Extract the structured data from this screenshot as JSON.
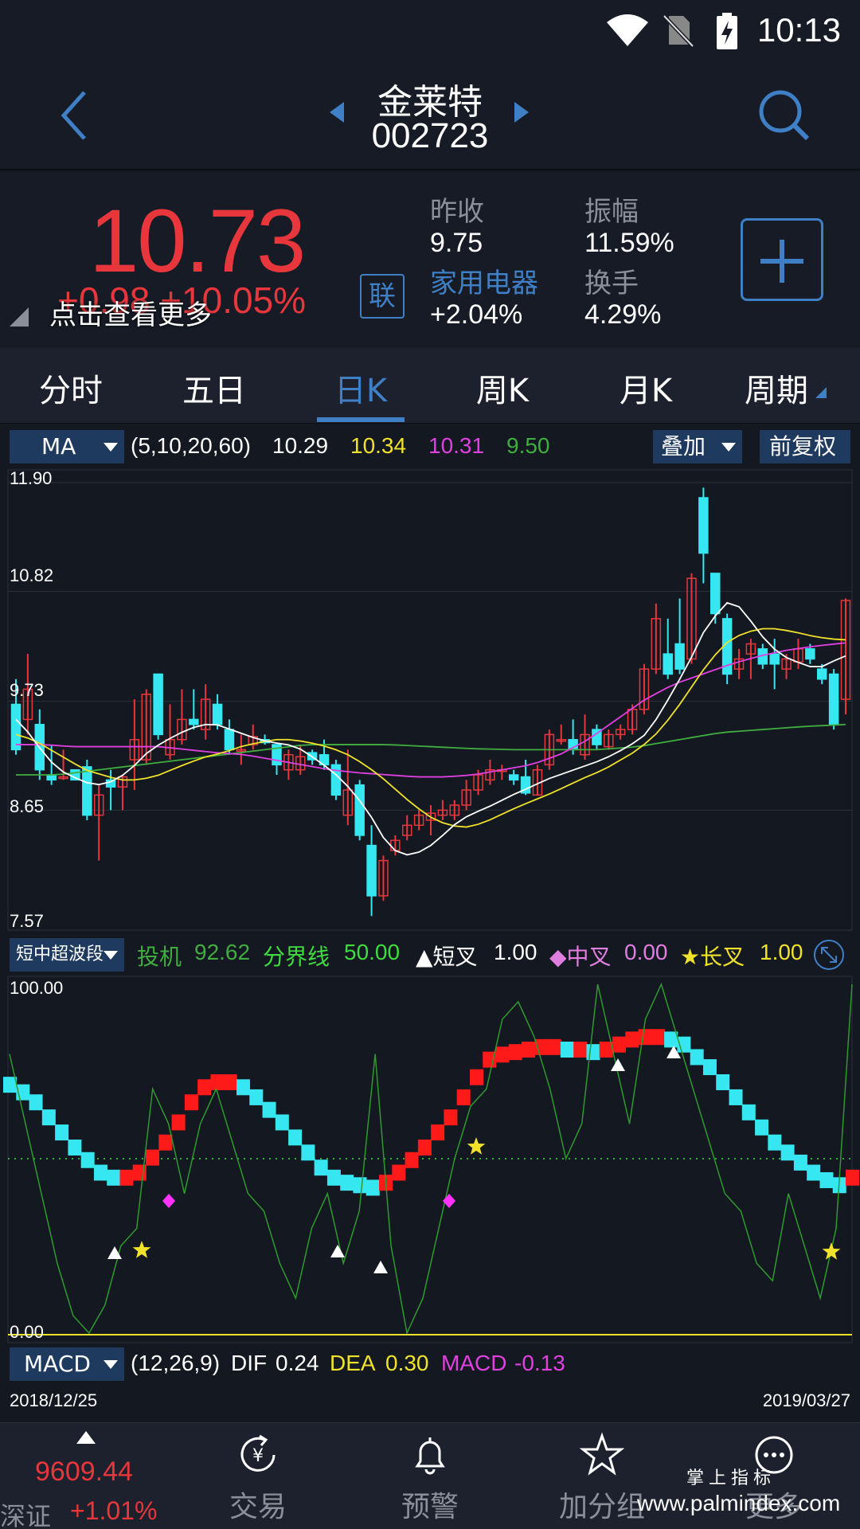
{
  "status": {
    "time": "10:13",
    "icons": [
      "wifi-icon",
      "no-sim-icon",
      "battery-charging-icon"
    ]
  },
  "header": {
    "name": "金莱特",
    "code": "002723"
  },
  "quote": {
    "price": "10.73",
    "change": "+0.98  +10.05%",
    "more_tip": "点击查看更多",
    "lian_label": "联",
    "prev_close_label": "昨收",
    "prev_close": "9.75",
    "amplitude_label": "振幅",
    "amplitude": "11.59%",
    "industry_label": "家用电器",
    "industry_change": "+2.04%",
    "turnover_label": "换手",
    "turnover": "4.29%"
  },
  "tabs": [
    "分时",
    "五日",
    "日K",
    "周K",
    "月K",
    "周期"
  ],
  "ma_bar": {
    "selector": "MA",
    "params": "(5,10,20,60)",
    "ma5": "10.29",
    "ma10": "10.34",
    "ma20": "10.31",
    "ma60": "9.50",
    "overlay": "叠加",
    "adjust": "前复权"
  },
  "price_axis": [
    "11.90",
    "10.82",
    "9.73",
    "8.65",
    "7.57"
  ],
  "indicator_bar": {
    "selector": "短中超波段",
    "t1_label": "投机",
    "t1_value": "92.62",
    "t2_label": "分界线",
    "t2_value": "50.00",
    "t3_label": "▲短叉",
    "t3_value": "1.00",
    "t4_label": "◆中叉",
    "t4_value": "0.00",
    "t5_label": "★长叉",
    "t5_value": "1.00"
  },
  "indicator_axis": [
    "100.00",
    "0.00"
  ],
  "macd_bar": {
    "selector": "MACD",
    "params": "(12,26,9)",
    "dif_label": "DIF",
    "dif": "0.24",
    "dea_label": "DEA",
    "dea": "0.30",
    "macd_label": "MACD",
    "macd": "-0.13"
  },
  "dates": {
    "start": "2018/12/25",
    "end": "2019/03/27"
  },
  "bottom_nav": {
    "index_value": "9609.44",
    "index_name": "深证",
    "index_change": "+1.01%",
    "items": [
      "交易",
      "预警",
      "加分组",
      "更多"
    ]
  },
  "watermark": {
    "line1": "掌上指标",
    "line2": "www.palmindex.com"
  },
  "colors": {
    "up": "#e7373c",
    "down": "#36e6f0",
    "accent": "#3f7fc6",
    "ma5": "#ffffff",
    "ma10": "#f0e22a",
    "ma20": "#e040e0",
    "ma60": "#3fae3f"
  },
  "chart_data": {
    "type": "candlestick",
    "ylim": [
      7.57,
      11.9
    ],
    "candles": [
      {
        "o": 9.7,
        "c": 9.25,
        "h": 9.95,
        "l": 9.2
      },
      {
        "o": 9.55,
        "c": 9.85,
        "h": 10.2,
        "l": 9.4
      },
      {
        "o": 9.5,
        "c": 9.05,
        "h": 9.65,
        "l": 8.95
      },
      {
        "o": 9.0,
        "c": 8.95,
        "h": 9.3,
        "l": 8.9
      },
      {
        "o": 8.98,
        "c": 8.98,
        "h": 9.25,
        "l": 8.95
      },
      {
        "o": 9.05,
        "c": 8.95,
        "h": 9.05,
        "l": 8.95
      },
      {
        "o": 9.08,
        "c": 8.6,
        "h": 9.15,
        "l": 8.55
      },
      {
        "o": 8.6,
        "c": 8.8,
        "h": 8.9,
        "l": 8.15
      },
      {
        "o": 8.95,
        "c": 8.88,
        "h": 9.05,
        "l": 8.65
      },
      {
        "o": 8.88,
        "c": 8.98,
        "h": 9.0,
        "l": 8.65
      },
      {
        "o": 9.15,
        "c": 9.35,
        "h": 9.75,
        "l": 8.85
      },
      {
        "o": 9.15,
        "c": 9.8,
        "h": 9.85,
        "l": 9.1
      },
      {
        "o": 10.0,
        "c": 9.4,
        "h": 10.0,
        "l": 9.35
      },
      {
        "o": 9.2,
        "c": 9.35,
        "h": 9.7,
        "l": 9.15
      },
      {
        "o": 9.35,
        "c": 9.55,
        "h": 9.85,
        "l": 9.3
      },
      {
        "o": 9.55,
        "c": 9.5,
        "h": 9.85,
        "l": 9.45
      },
      {
        "o": 9.45,
        "c": 9.75,
        "h": 9.9,
        "l": 9.35
      },
      {
        "o": 9.7,
        "c": 9.5,
        "h": 9.8,
        "l": 9.45
      },
      {
        "o": 9.45,
        "c": 9.25,
        "h": 9.55,
        "l": 9.2
      },
      {
        "o": 9.25,
        "c": 9.25,
        "h": 9.4,
        "l": 9.1
      },
      {
        "o": 9.3,
        "c": 9.38,
        "h": 9.5,
        "l": 9.25
      },
      {
        "o": 9.35,
        "c": 9.32,
        "h": 9.4,
        "l": 9.3
      },
      {
        "o": 9.3,
        "c": 9.1,
        "h": 9.3,
        "l": 9.0
      },
      {
        "o": 9.05,
        "c": 9.2,
        "h": 9.25,
        "l": 8.95
      },
      {
        "o": 9.05,
        "c": 9.18,
        "h": 9.3,
        "l": 9.0
      },
      {
        "o": 9.22,
        "c": 9.15,
        "h": 9.25,
        "l": 9.1
      },
      {
        "o": 9.2,
        "c": 9.1,
        "h": 9.35,
        "l": 9.05
      },
      {
        "o": 9.1,
        "c": 8.8,
        "h": 9.15,
        "l": 8.75
      },
      {
        "o": 8.6,
        "c": 8.85,
        "h": 9.25,
        "l": 8.5
      },
      {
        "o": 8.9,
        "c": 8.4,
        "h": 8.95,
        "l": 8.35
      },
      {
        "o": 8.3,
        "c": 7.8,
        "h": 8.5,
        "l": 7.6
      },
      {
        "o": 7.8,
        "c": 8.15,
        "h": 8.2,
        "l": 7.75
      },
      {
        "o": 8.25,
        "c": 8.35,
        "h": 8.4,
        "l": 8.2
      },
      {
        "o": 8.4,
        "c": 8.5,
        "h": 8.6,
        "l": 8.35
      },
      {
        "o": 8.5,
        "c": 8.6,
        "h": 8.65,
        "l": 8.45
      },
      {
        "o": 8.55,
        "c": 8.62,
        "h": 8.7,
        "l": 8.4
      },
      {
        "o": 8.6,
        "c": 8.65,
        "h": 8.75,
        "l": 8.55
      },
      {
        "o": 8.6,
        "c": 8.7,
        "h": 8.75,
        "l": 8.55
      },
      {
        "o": 8.7,
        "c": 8.85,
        "h": 8.95,
        "l": 8.65
      },
      {
        "o": 8.85,
        "c": 9.0,
        "h": 9.05,
        "l": 8.8
      },
      {
        "o": 8.95,
        "c": 9.05,
        "h": 9.15,
        "l": 8.9
      },
      {
        "o": 9.05,
        "c": 9.05,
        "h": 9.1,
        "l": 8.95
      },
      {
        "o": 9.0,
        "c": 8.95,
        "h": 9.05,
        "l": 8.9
      },
      {
        "o": 8.98,
        "c": 8.82,
        "h": 9.15,
        "l": 8.8
      },
      {
        "o": 8.8,
        "c": 9.05,
        "h": 9.1,
        "l": 8.8
      },
      {
        "o": 9.1,
        "c": 9.4,
        "h": 9.45,
        "l": 9.05
      },
      {
        "o": 9.35,
        "c": 9.35,
        "h": 9.5,
        "l": 9.3
      },
      {
        "o": 9.35,
        "c": 9.25,
        "h": 9.55,
        "l": 9.2
      },
      {
        "o": 9.2,
        "c": 9.4,
        "h": 9.6,
        "l": 9.15
      },
      {
        "o": 9.45,
        "c": 9.3,
        "h": 9.5,
        "l": 9.25
      },
      {
        "o": 9.28,
        "c": 9.4,
        "h": 9.45,
        "l": 9.25
      },
      {
        "o": 9.4,
        "c": 9.45,
        "h": 9.5,
        "l": 9.35
      },
      {
        "o": 9.45,
        "c": 9.65,
        "h": 9.7,
        "l": 9.4
      },
      {
        "o": 9.65,
        "c": 10.05,
        "h": 10.1,
        "l": 9.6
      },
      {
        "o": 10.05,
        "c": 10.55,
        "h": 10.7,
        "l": 10.0
      },
      {
        "o": 10.2,
        "c": 10.0,
        "h": 10.55,
        "l": 9.95
      },
      {
        "o": 10.3,
        "c": 10.05,
        "h": 10.75,
        "l": 10.0
      },
      {
        "o": 10.15,
        "c": 10.95,
        "h": 11.0,
        "l": 10.1
      },
      {
        "o": 11.75,
        "c": 11.2,
        "h": 11.85,
        "l": 10.9
      },
      {
        "o": 11.0,
        "c": 10.6,
        "h": 11.0,
        "l": 10.5
      },
      {
        "o": 10.55,
        "c": 10.0,
        "h": 10.6,
        "l": 9.9
      },
      {
        "o": 10.05,
        "c": 10.15,
        "h": 10.25,
        "l": 9.95
      },
      {
        "o": 10.2,
        "c": 10.3,
        "h": 10.35,
        "l": 9.95
      },
      {
        "o": 10.25,
        "c": 10.1,
        "h": 10.3,
        "l": 10.05
      },
      {
        "o": 10.2,
        "c": 10.1,
        "h": 10.35,
        "l": 9.85
      },
      {
        "o": 10.05,
        "c": 10.15,
        "h": 10.2,
        "l": 9.95
      },
      {
        "o": 10.12,
        "c": 10.25,
        "h": 10.35,
        "l": 10.05
      },
      {
        "o": 10.25,
        "c": 10.15,
        "h": 10.3,
        "l": 10.1
      },
      {
        "o": 10.05,
        "c": 9.95,
        "h": 10.1,
        "l": 9.9
      },
      {
        "o": 10.0,
        "c": 9.5,
        "h": 10.05,
        "l": 9.45
      },
      {
        "o": 9.75,
        "c": 10.73,
        "h": 10.75,
        "l": 9.6
      }
    ],
    "ma5": [
      9.55,
      9.4,
      9.2,
      9.05,
      8.98,
      8.92,
      8.9,
      8.95,
      9.05,
      9.2,
      9.3,
      9.38,
      9.45,
      9.5,
      9.5,
      9.45,
      9.4,
      9.35,
      9.32,
      9.3,
      9.25,
      9.15,
      9.05,
      8.92,
      8.75,
      8.55,
      8.3,
      8.2,
      8.22,
      8.3,
      8.42,
      8.55,
      8.62,
      8.68,
      8.75,
      8.82,
      8.88,
      8.95,
      9.0,
      9.05,
      9.1,
      9.15,
      9.22,
      9.3,
      9.4,
      9.6,
      9.85,
      10.1,
      10.4,
      10.6,
      10.75,
      10.6,
      10.4,
      10.25,
      10.15,
      10.1,
      10.05,
      10.12,
      10.18
    ],
    "ma10": [
      9.4,
      9.35,
      9.25,
      9.15,
      9.05,
      9.0,
      8.95,
      8.95,
      8.98,
      9.05,
      9.12,
      9.18,
      9.22,
      9.28,
      9.32,
      9.35,
      9.35,
      9.32,
      9.28,
      9.22,
      9.12,
      9.0,
      8.85,
      8.7,
      8.58,
      8.5,
      8.48,
      8.52,
      8.6,
      8.68,
      8.75,
      8.82,
      8.9,
      8.98,
      9.05,
      9.15,
      9.25,
      9.4,
      9.6,
      9.85,
      10.1,
      10.3,
      10.4,
      10.45,
      10.45,
      10.42,
      10.38,
      10.35,
      10.34
    ],
    "ma20": [
      9.3,
      9.3,
      9.28,
      9.28,
      9.28,
      9.28,
      9.25,
      9.22,
      9.2,
      9.15,
      9.1,
      9.05,
      9.02,
      9.0,
      8.98,
      8.98,
      9.0,
      9.05,
      9.1,
      9.2,
      9.35,
      9.55,
      9.75,
      9.9,
      10.0,
      10.1,
      10.18,
      10.24,
      10.28,
      10.31
    ],
    "ma60": [
      9.0,
      9.0,
      9.05,
      9.1,
      9.15,
      9.2,
      9.25,
      9.3,
      9.3,
      9.3,
      9.28,
      9.26,
      9.25,
      9.25,
      9.25,
      9.28,
      9.35,
      9.42,
      9.45,
      9.48,
      9.5
    ]
  }
}
